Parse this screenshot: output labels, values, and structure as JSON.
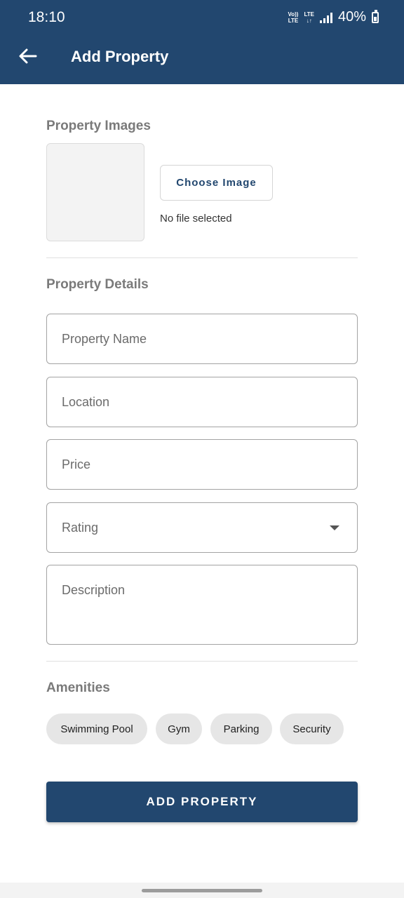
{
  "colors": {
    "primary": "#22476f",
    "section_heading": "#7a7a7a",
    "chip_bg": "#e6e6e6",
    "field_border": "#a3a3a3"
  },
  "status_bar": {
    "time": "18:10",
    "net_top": "Vo)) LTE",
    "net_bottom": "LTE",
    "battery": "40%"
  },
  "header": {
    "back_icon": "arrow-left-icon",
    "title": "Add Property"
  },
  "images_section": {
    "title": "Property Images",
    "choose_button": "Choose Image",
    "file_status": "No file selected"
  },
  "details_section": {
    "title": "Property Details",
    "name_placeholder": "Property Name",
    "location_placeholder": "Location",
    "price_placeholder": "Price",
    "rating_placeholder": "Rating",
    "description_placeholder": "Description"
  },
  "amenities_section": {
    "title": "Amenities",
    "chips": [
      "Swimming Pool",
      "Gym",
      "Parking",
      "Security"
    ]
  },
  "submit_label": "ADD PROPERTY"
}
